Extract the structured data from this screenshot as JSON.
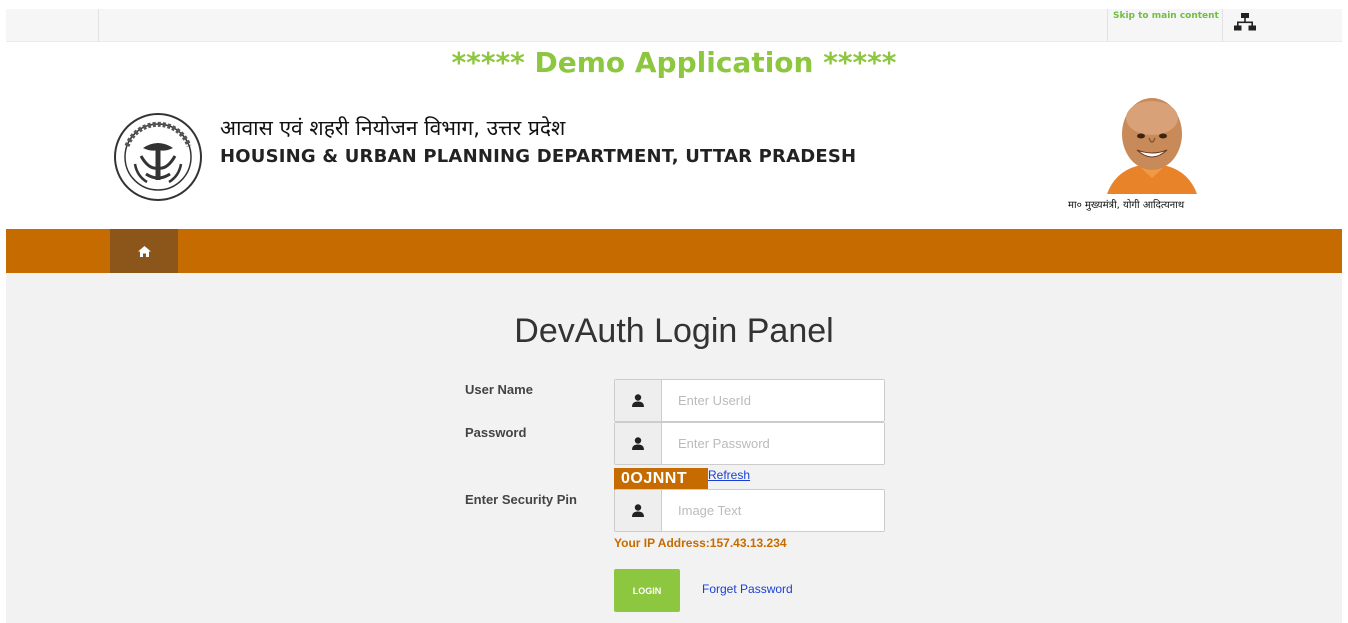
{
  "topbar": {
    "skip_link": "Skip to main content",
    "sitemap_icon": "sitemap-icon"
  },
  "header": {
    "demo_title": "***** Demo Application *****",
    "dept_hindi": "आवास एवं शहरी नियोजन विभाग, उत्तर प्रदेश",
    "dept_english": "HOUSING & URBAN PLANNING DEPARTMENT, UTTAR PRADESH",
    "cm_caption": "मा० मुख्यमंत्री, योगी आदित्यनाथ"
  },
  "nav": {
    "home_icon": "home-icon"
  },
  "login": {
    "title": "DevAuth Login Panel",
    "username_label": "User Name",
    "username_placeholder": "Enter UserId",
    "password_label": "Password",
    "password_placeholder": "Enter Password",
    "captcha_text": "0OJNNT",
    "refresh_label": "Refresh",
    "pin_label": "Enter Security Pin",
    "pin_placeholder": "Image Text",
    "ip_text": "Your IP Address:157.43.13.234",
    "login_button": "LOGIN",
    "forget_link": "Forget Password"
  },
  "colors": {
    "accent_green": "#8dc63f",
    "nav_orange": "#c66b00",
    "home_dark": "#8c5519",
    "link_blue": "#1a3fd6"
  }
}
